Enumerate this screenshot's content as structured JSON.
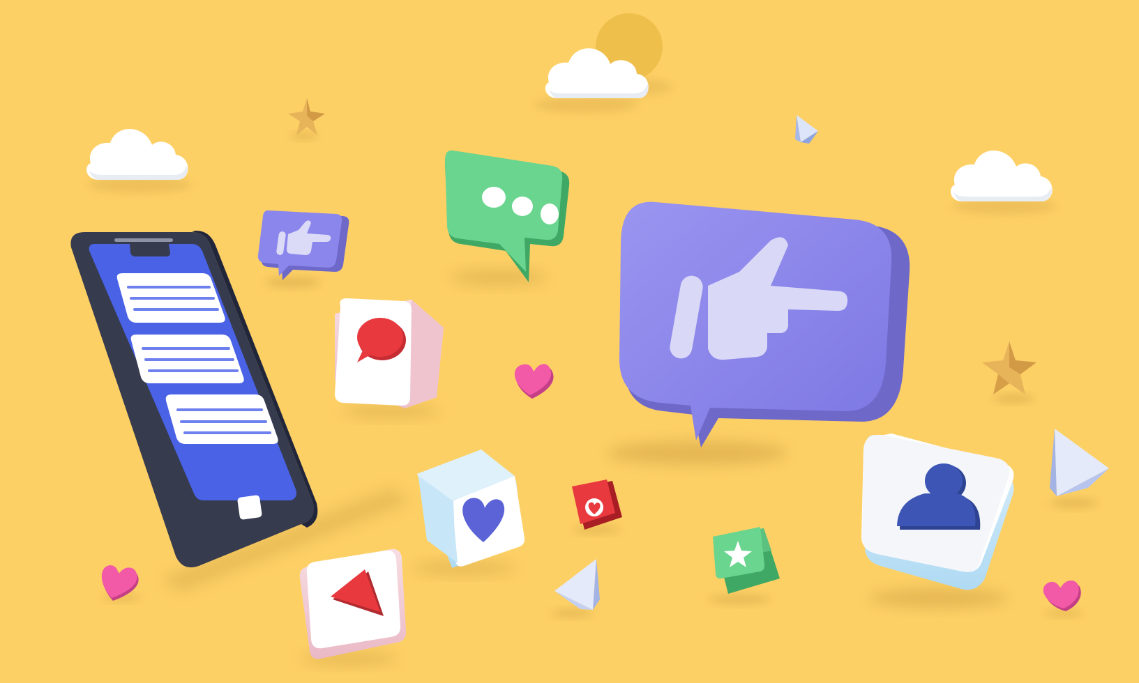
{
  "scene": {
    "background": "#FDD066",
    "colors": {
      "phone_body": "#363B4E",
      "phone_screen": "#4A62E6",
      "message_line": "#6E80EE",
      "cloud": "#FFFFFF",
      "sun": "#F2C24F",
      "star": "#E8B45A",
      "heart": "#F25AA7",
      "purple_bubble": "#8B86EC",
      "purple_bubble_side": "#6E68C9",
      "hand": "#D9D8F7",
      "green_bubble": "#6AD58E",
      "green_bubble_side": "#3FA864",
      "red_icon": "#E8393E",
      "blue_heart": "#5B63D6",
      "user_icon": "#3D56B5",
      "crystal": "#B9C6EE"
    },
    "elements": [
      {
        "id": "smartphone",
        "icon": "smartphone-icon",
        "detail": "chat-messages-screen"
      },
      {
        "id": "cloud-left",
        "icon": "cloud-icon"
      },
      {
        "id": "cloud-top",
        "icon": "cloud-icon"
      },
      {
        "id": "sun",
        "icon": "sun-icon"
      },
      {
        "id": "cloud-right",
        "icon": "cloud-icon"
      },
      {
        "id": "star-top-left",
        "icon": "star-icon"
      },
      {
        "id": "star-right",
        "icon": "star-icon"
      },
      {
        "id": "typing-bubble",
        "icon": "speech-bubble-icon"
      },
      {
        "id": "small-pointing-bubble",
        "icon": "pointing-hand-icon"
      },
      {
        "id": "large-pointing-bubble",
        "icon": "pointing-hand-icon"
      },
      {
        "id": "comment-cube",
        "icon": "comment-icon"
      },
      {
        "id": "heart-cube",
        "icon": "heart-icon"
      },
      {
        "id": "play-cube",
        "icon": "play-icon"
      },
      {
        "id": "small-heart-cube",
        "icon": "heart-icon"
      },
      {
        "id": "star-cube",
        "icon": "star-icon"
      },
      {
        "id": "user-cube",
        "icon": "user-icon"
      },
      {
        "id": "heart-center",
        "icon": "heart-icon"
      },
      {
        "id": "heart-bottom-left",
        "icon": "heart-icon"
      },
      {
        "id": "heart-bottom-right",
        "icon": "heart-icon"
      },
      {
        "id": "crystal-small",
        "icon": "diamond-icon"
      },
      {
        "id": "crystal-center",
        "icon": "diamond-icon"
      },
      {
        "id": "crystal-right",
        "icon": "diamond-icon"
      }
    ]
  }
}
